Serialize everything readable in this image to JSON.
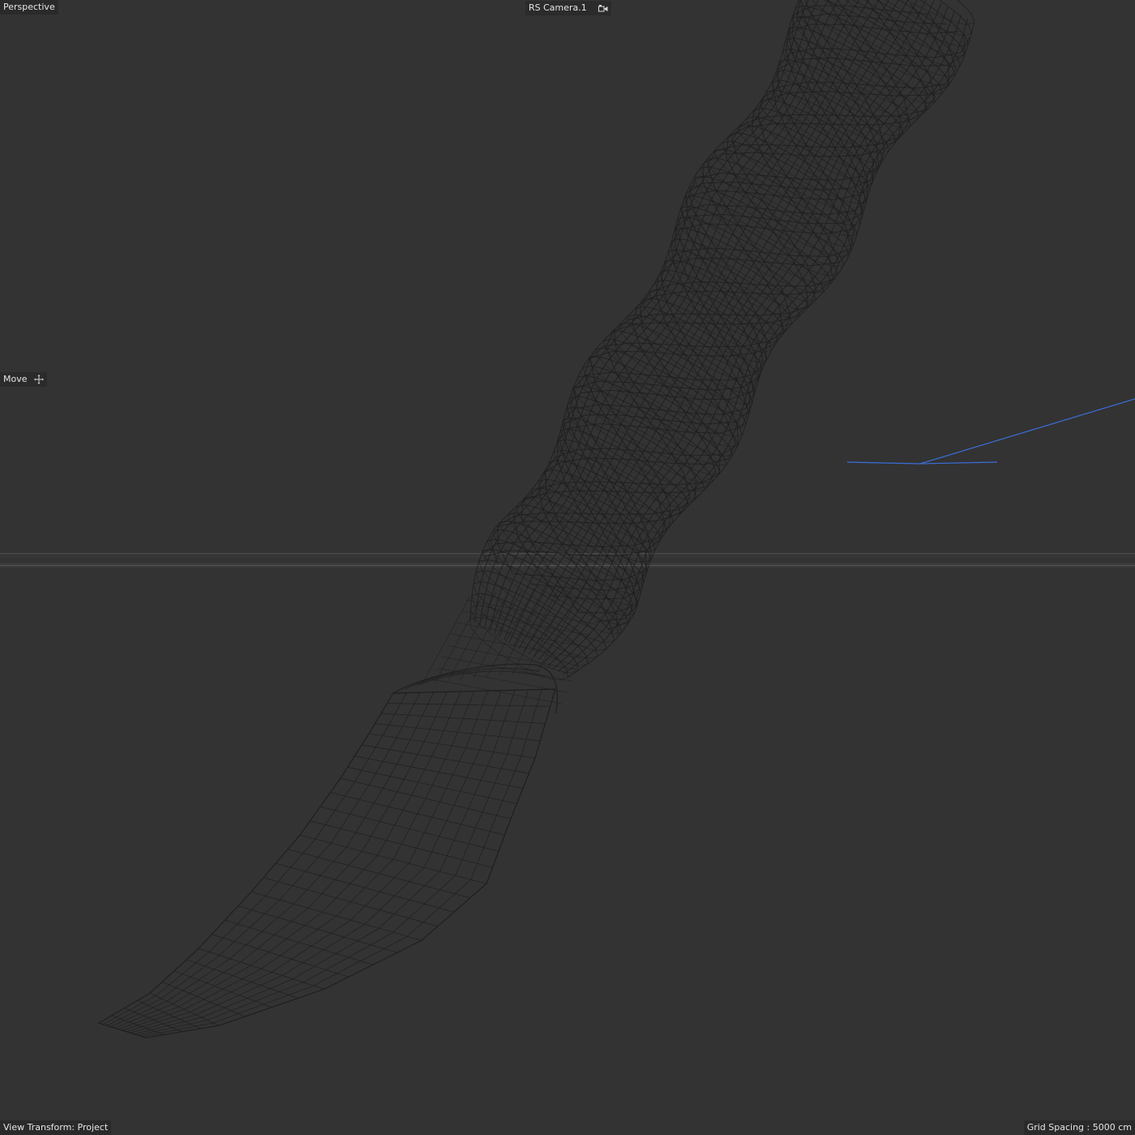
{
  "viewport": {
    "view_name": "Perspective",
    "camera_name": "RS Camera.1",
    "camera_icon": "camera-icon",
    "tool_name": "Move",
    "tool_icon": "move-icon",
    "view_transform": "View Transform: Project",
    "grid_spacing": "Grid Spacing : 5000 cm"
  },
  "colors": {
    "background": "#333333",
    "wireframe": "#1e1e1e",
    "horizon": "#4a4a4a",
    "spline": "#3a6fd8"
  }
}
